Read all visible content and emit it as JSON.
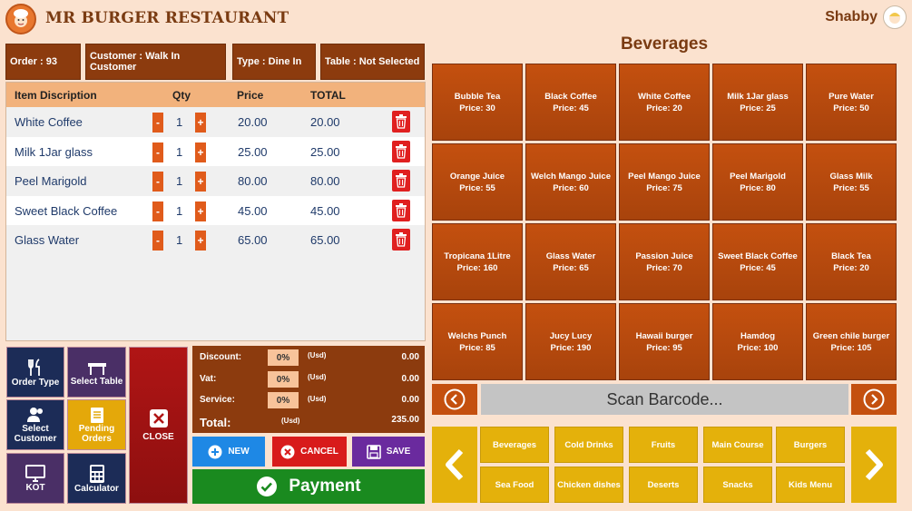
{
  "app": {
    "title": "MR BURGER RESTAURANT",
    "user": "Shabby"
  },
  "order_info": {
    "order": "Order : 93",
    "customer": "Customer :  Walk In Customer",
    "type": "Type : Dine In",
    "table": "Table :  Not Selected"
  },
  "cart": {
    "headers": {
      "item": "Item Discription",
      "qty": "Qty",
      "price": "Price",
      "total": "TOTAL"
    },
    "items": [
      {
        "name": "White Coffee",
        "qty": "1",
        "price": "20.00",
        "total": "20.00"
      },
      {
        "name": "Milk 1Jar glass",
        "qty": "1",
        "price": "25.00",
        "total": "25.00"
      },
      {
        "name": "Peel Marigold",
        "qty": "1",
        "price": "80.00",
        "total": "80.00"
      },
      {
        "name": "Sweet Black Coffee",
        "qty": "1",
        "price": "45.00",
        "total": "45.00"
      },
      {
        "name": "Glass Water",
        "qty": "1",
        "price": "65.00",
        "total": "65.00"
      }
    ],
    "minus": "-",
    "plus": "+"
  },
  "left_buttons": {
    "order_type": "Order Type",
    "select_table": "Select Table",
    "close": "CLOSE",
    "select_customer": "Select Customer",
    "pending_orders": "Pending Orders",
    "kot": "KOT",
    "calculator": "Calculator"
  },
  "totals": {
    "discount_label": "Discount:",
    "discount_pct": "0%",
    "discount_value": "0.00",
    "vat_label": "Vat:",
    "vat_pct": "0%",
    "vat_value": "0.00",
    "service_label": "Service:",
    "service_pct": "0%",
    "service_value": "0.00",
    "total_label": "Total:",
    "total_value": "235.00",
    "usd": "(Usd)"
  },
  "actions": {
    "new": "NEW",
    "cancel": "CANCEL",
    "save": "SAVE",
    "payment": "Payment"
  },
  "category_title": "Beverages",
  "products": [
    {
      "name": "Bubble Tea",
      "price": "Price: 30"
    },
    {
      "name": "Black Coffee",
      "price": "Price: 45"
    },
    {
      "name": "White Coffee",
      "price": "Price: 20"
    },
    {
      "name": "Milk 1Jar glass",
      "price": "Price: 25"
    },
    {
      "name": "Pure Water",
      "price": "Price: 50"
    },
    {
      "name": "Orange Juice",
      "price": "Price: 55"
    },
    {
      "name": "Welch Mango Juice",
      "price": "Price: 60"
    },
    {
      "name": "Peel Mango Juice",
      "price": "Price: 75"
    },
    {
      "name": "Peel Marigold",
      "price": "Price: 80"
    },
    {
      "name": "Glass Milk",
      "price": "Price: 55"
    },
    {
      "name": "Tropicana 1Litre",
      "price": "Price: 160"
    },
    {
      "name": "Glass Water",
      "price": "Price: 65"
    },
    {
      "name": "Passion Juice",
      "price": "Price: 70"
    },
    {
      "name": "Sweet Black Coffee",
      "price": "Price: 45"
    },
    {
      "name": "Black Tea",
      "price": "Price: 20"
    },
    {
      "name": "Welchs Punch",
      "price": "Price: 85"
    },
    {
      "name": "Jucy Lucy",
      "price": "Price: 190"
    },
    {
      "name": "Hawaii burger",
      "price": "Price: 95"
    },
    {
      "name": "Hamdog",
      "price": "Price: 100"
    },
    {
      "name": "Green chile burger",
      "price": "Price: 105"
    }
  ],
  "scan_placeholder": "Scan Barcode...",
  "categories": [
    "Beverages",
    "Cold Drinks",
    "Fruits",
    "Main Course",
    "Burgers",
    "Sea Food",
    "Chicken dishes",
    "Deserts",
    "Snacks",
    "Kids Menu"
  ],
  "colors": {
    "brown": "#8c3b0e",
    "orange": "#c4500f",
    "yellow": "#e4b10b",
    "green": "#1a8a1f",
    "red": "#d81b1b",
    "navy": "#1c2c57"
  }
}
